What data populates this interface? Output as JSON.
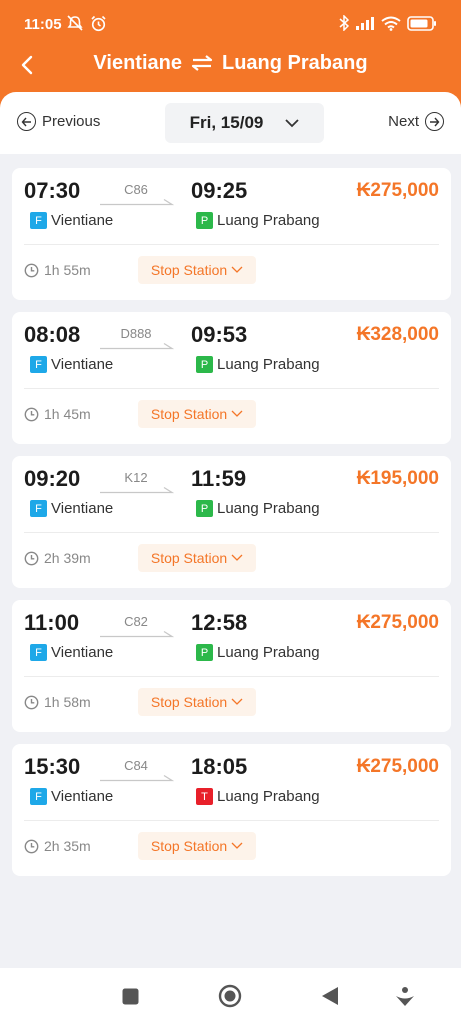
{
  "status_bar": {
    "time": "11:05",
    "battery_level": 0.85
  },
  "header": {
    "from": "Vientiane",
    "to": "Luang Prabang",
    "swap_icon": "swap-icon",
    "back_icon": "chevron-left-icon"
  },
  "date_bar": {
    "previous_label": "Previous",
    "date": "Fri, 15/09",
    "next_label": "Next"
  },
  "trains": [
    {
      "dep_time": "07:30",
      "code": "C86",
      "arr_time": "09:25",
      "price": "₭275,000",
      "from_badge": "F",
      "from_station": "Vientiane",
      "to_badge": "P",
      "to_station": "Luang Prabang",
      "duration": "1h 55m",
      "stop_label": "Stop Station"
    },
    {
      "dep_time": "08:08",
      "code": "D888",
      "arr_time": "09:53",
      "price": "₭328,000",
      "from_badge": "F",
      "from_station": "Vientiane",
      "to_badge": "P",
      "to_station": "Luang Prabang",
      "duration": "1h 45m",
      "stop_label": "Stop Station"
    },
    {
      "dep_time": "09:20",
      "code": "K12",
      "arr_time": "11:59",
      "price": "₭195,000",
      "from_badge": "F",
      "from_station": "Vientiane",
      "to_badge": "P",
      "to_station": "Luang Prabang",
      "duration": "2h 39m",
      "stop_label": "Stop Station"
    },
    {
      "dep_time": "11:00",
      "code": "C82",
      "arr_time": "12:58",
      "price": "₭275,000",
      "from_badge": "F",
      "from_station": "Vientiane",
      "to_badge": "P",
      "to_station": "Luang Prabang",
      "duration": "1h 58m",
      "stop_label": "Stop Station"
    },
    {
      "dep_time": "15:30",
      "code": "C84",
      "arr_time": "18:05",
      "price": "₭275,000",
      "from_badge": "F",
      "from_station": "Vientiane",
      "to_badge": "T",
      "to_station": "Luang Prabang",
      "duration": "2h 35m",
      "stop_label": "Stop Station"
    }
  ],
  "colors": {
    "accent": "#f47628",
    "badge_F": "#1ea8e8",
    "badge_P": "#2cb84a",
    "badge_T": "#e8202a"
  }
}
